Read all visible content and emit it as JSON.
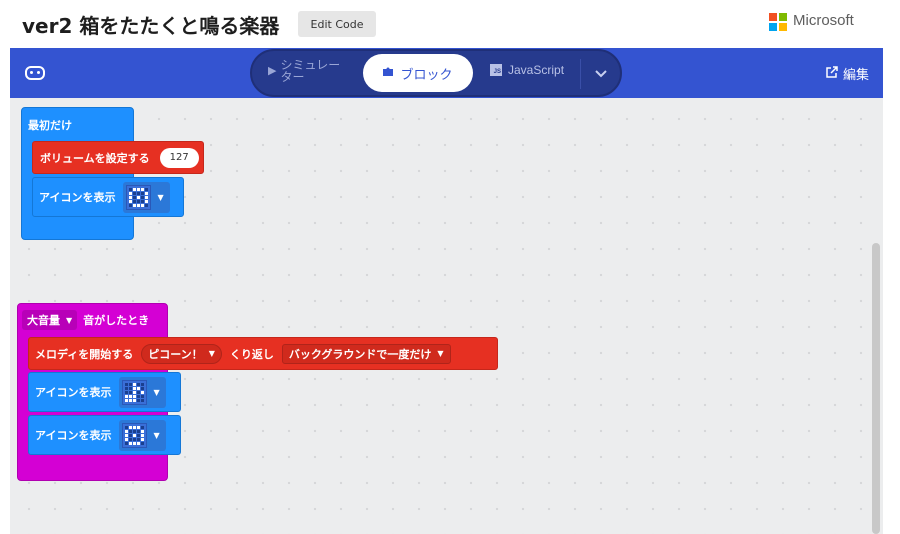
{
  "header": {
    "project_title": "ver2 箱をたたくと鳴る楽器",
    "edit_code_label": "Edit Code",
    "brand": "Microsoft"
  },
  "nav": {
    "simulator_label": "シミュレーター",
    "blocks_label": "ブロック",
    "javascript_label": "JavaScript",
    "edit_label": "編集"
  },
  "workspace": {
    "on_start": {
      "hat_label": "最初だけ",
      "set_volume_label": "ボリュームを設定する",
      "volume_value": "127",
      "show_icon_label": "アイコンを表示"
    },
    "on_loud": {
      "sound_dropdown": "大音量",
      "hat_suffix": "音がしたとき",
      "melody_label": "メロディを開始する",
      "melody_value": "ピコーン！",
      "repeat_label": "くり返し",
      "repeat_value": "バックグラウンドで一度だけ",
      "show_icon_label_1": "アイコンを表示",
      "show_icon_label_2": "アイコンを表示"
    }
  },
  "colors": {
    "nav_bg": "#3454d1",
    "basic_block": "#1e90ff",
    "music_block": "#e63022",
    "input_hat": "#d400d4"
  },
  "icons": {
    "device": "microbit-icon",
    "simulator": "play-icon",
    "blocks": "puzzle-icon",
    "javascript": "js-icon",
    "expand": "chevron-down-icon",
    "edit": "external-link-icon"
  }
}
